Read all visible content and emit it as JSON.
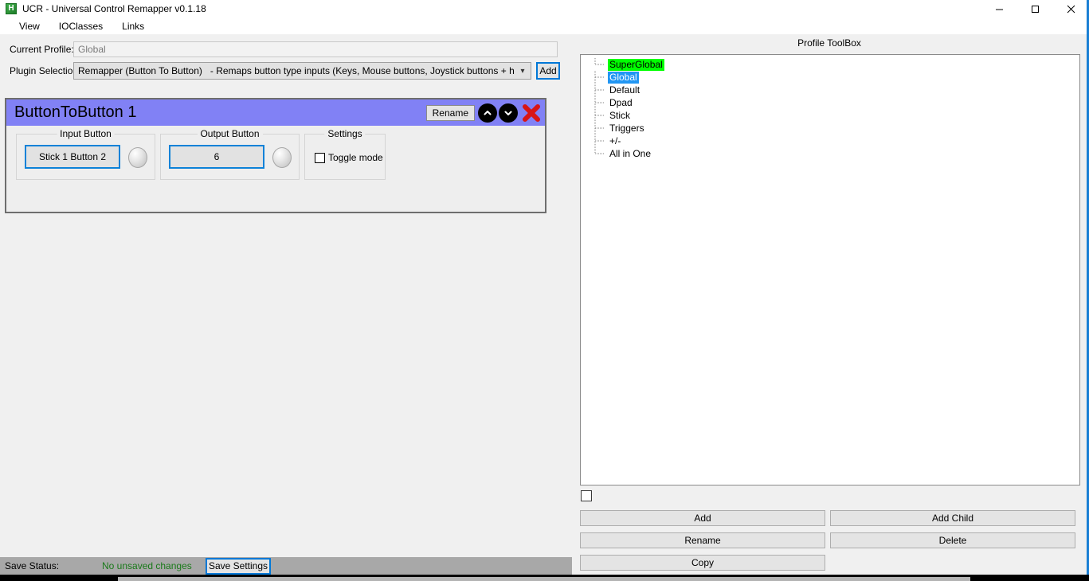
{
  "window": {
    "title": "UCR - Universal Control Remapper v0.1.18",
    "icon": "app-icon-h",
    "icon_letter": "H",
    "controls": {
      "minimize": "minimize-icon",
      "maximize": "maximize-icon",
      "close": "close-icon"
    }
  },
  "menu": {
    "items": [
      {
        "label": "View"
      },
      {
        "label": "IOClasses"
      },
      {
        "label": "Links"
      }
    ]
  },
  "profile_row": {
    "label": "Current Profile:",
    "value": "Global",
    "placeholder": "Global"
  },
  "plugin_row": {
    "label": "Plugin Selection:",
    "selected_name": "Remapper (Button To Button)",
    "selected_desc": "- Remaps button type inputs (Keys, Mouse buttons, Joystick buttons + hat directions)",
    "dropdown_icon": "chevron-down-icon",
    "add_label": "Add"
  },
  "plugin_panel": {
    "title": "ButtonToButton 1",
    "header_color": "#8181f5",
    "rename_label": "Rename",
    "move_up_icon": "chevron-up-icon",
    "move_down_icon": "chevron-down-icon",
    "delete_icon": "close-x-icon",
    "groups": [
      {
        "label": "Input Button",
        "binding": "Stick 1 Button 2",
        "has_led": true
      },
      {
        "label": "Output Button",
        "binding": "6",
        "has_led": true
      }
    ],
    "settings": {
      "label": "Settings",
      "toggle_mode_label": "Toggle mode",
      "toggle_mode_checked": false
    }
  },
  "status_bar": {
    "label": "Save Status:",
    "value": "No unsaved changes",
    "value_color": "#1a7a1a",
    "save_label": "Save Settings"
  },
  "toolbox": {
    "title": "Profile ToolBox",
    "tree": [
      {
        "label": "SuperGlobal",
        "highlight": "green"
      },
      {
        "label": "Global",
        "highlight": "blue"
      },
      {
        "label": "Default",
        "highlight": "none"
      },
      {
        "label": "Dpad",
        "highlight": "none"
      },
      {
        "label": "Stick",
        "highlight": "none"
      },
      {
        "label": "Triggers",
        "highlight": "none"
      },
      {
        "label": "+/-",
        "highlight": "none"
      },
      {
        "label": "All in One",
        "highlight": "none"
      }
    ],
    "checkbox_checked": false,
    "buttons": {
      "add": "Add",
      "add_child": "Add Child",
      "rename": "Rename",
      "delete": "Delete",
      "copy": "Copy"
    }
  }
}
